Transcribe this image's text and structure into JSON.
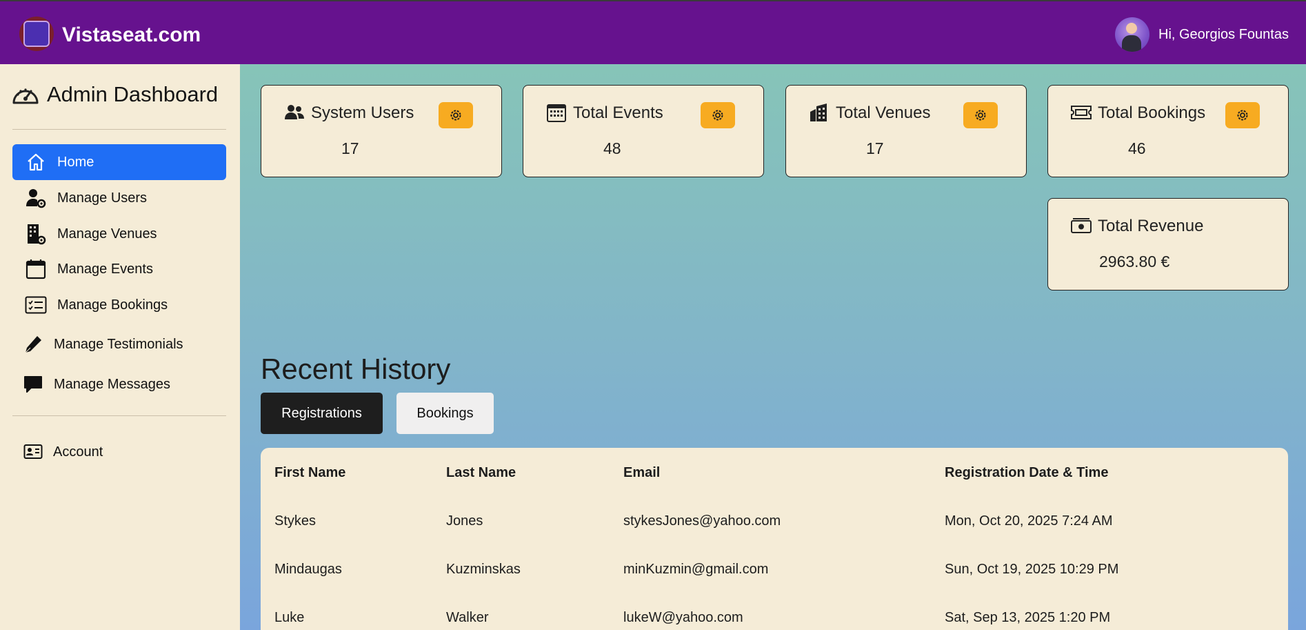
{
  "header": {
    "brand": "Vistaseat.com",
    "greeting": "Hi, Georgios Fountas"
  },
  "sidebar": {
    "title": "Admin Dashboard",
    "items": [
      {
        "label": "Home",
        "icon": "home-icon",
        "active": true
      },
      {
        "label": "Manage Users",
        "icon": "user-gear-icon"
      },
      {
        "label": "Manage Venues",
        "icon": "building-gear-icon"
      },
      {
        "label": "Manage Events",
        "icon": "calendar-icon"
      },
      {
        "label": "Manage Bookings",
        "icon": "checklist-icon"
      },
      {
        "label": "Manage Testimonials",
        "icon": "pen-icon"
      },
      {
        "label": "Manage Messages",
        "icon": "message-icon"
      }
    ],
    "account": {
      "label": "Account",
      "icon": "id-card-icon"
    }
  },
  "stats": [
    {
      "title": "System Users",
      "value": "17",
      "icon": "users-icon"
    },
    {
      "title": "Total Events",
      "value": "48",
      "icon": "calendar-grid-icon"
    },
    {
      "title": "Total Venues",
      "value": "17",
      "icon": "buildings-icon"
    },
    {
      "title": "Total Bookings",
      "value": "46",
      "icon": "ticket-icon"
    },
    {
      "title": "Total Revenue",
      "value": "2963.80 €",
      "icon": "cash-icon"
    }
  ],
  "history": {
    "title": "Recent History",
    "tabs": [
      {
        "label": "Registrations",
        "active": true
      },
      {
        "label": "Bookings",
        "active": false
      }
    ],
    "columns": [
      "First Name",
      "Last Name",
      "Email",
      "Registration Date & Time"
    ],
    "rows": [
      [
        "Stykes",
        "Jones",
        "stykesJones@yahoo.com",
        "Mon, Oct 20, 2025 7:24 AM"
      ],
      [
        "Mindaugas",
        "Kuzminskas",
        "minKuzmin@gmail.com",
        "Sun, Oct 19, 2025 10:29 PM"
      ],
      [
        "Luke",
        "Walker",
        "lukeW@yahoo.com",
        "Sat, Sep 13, 2025 1:20 PM"
      ]
    ]
  },
  "colors": {
    "header_bg": "#66128e",
    "sidebar_bg": "#f5ecd7",
    "active_nav": "#1f6ef5",
    "gear_button": "#f7ab21",
    "dark_tab": "#1e1e1e"
  }
}
